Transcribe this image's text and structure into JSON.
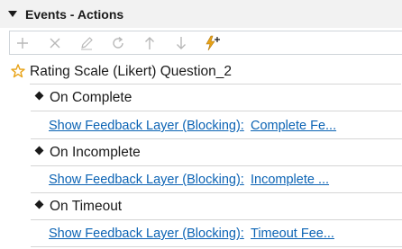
{
  "panel": {
    "title": "Events - Actions"
  },
  "toolbar": {
    "buttons": [
      {
        "icon": "plus-icon",
        "label": "Add"
      },
      {
        "icon": "close-icon",
        "label": "Delete"
      },
      {
        "icon": "pencil-icon",
        "label": "Edit"
      },
      {
        "icon": "refresh-icon",
        "label": "Refresh"
      },
      {
        "icon": "arrow-up-icon",
        "label": "Move Up"
      },
      {
        "icon": "arrow-down-icon",
        "label": "Move Down"
      },
      {
        "icon": "lightning-plus-icon",
        "label": "Add Trigger"
      }
    ]
  },
  "tree": {
    "question": {
      "label": "Rating Scale (Likert) Question_2",
      "icon": "star-icon"
    },
    "events": [
      {
        "label": "On Complete",
        "action_type": "Show Feedback Layer (Blocking):",
        "action_target": "Complete Fe..."
      },
      {
        "label": "On Incomplete",
        "action_type": "Show Feedback Layer (Blocking):",
        "action_target": "Incomplete ..."
      },
      {
        "label": "On Timeout",
        "action_type": "Show Feedback Layer (Blocking):",
        "action_target": "Timeout Fee..."
      }
    ]
  },
  "colors": {
    "link": "#0b63b4",
    "header_bg": "#f2f2f2",
    "star": "#e8a317",
    "lightning": "#e8a317",
    "disabled_icon": "#b8b8b8"
  }
}
